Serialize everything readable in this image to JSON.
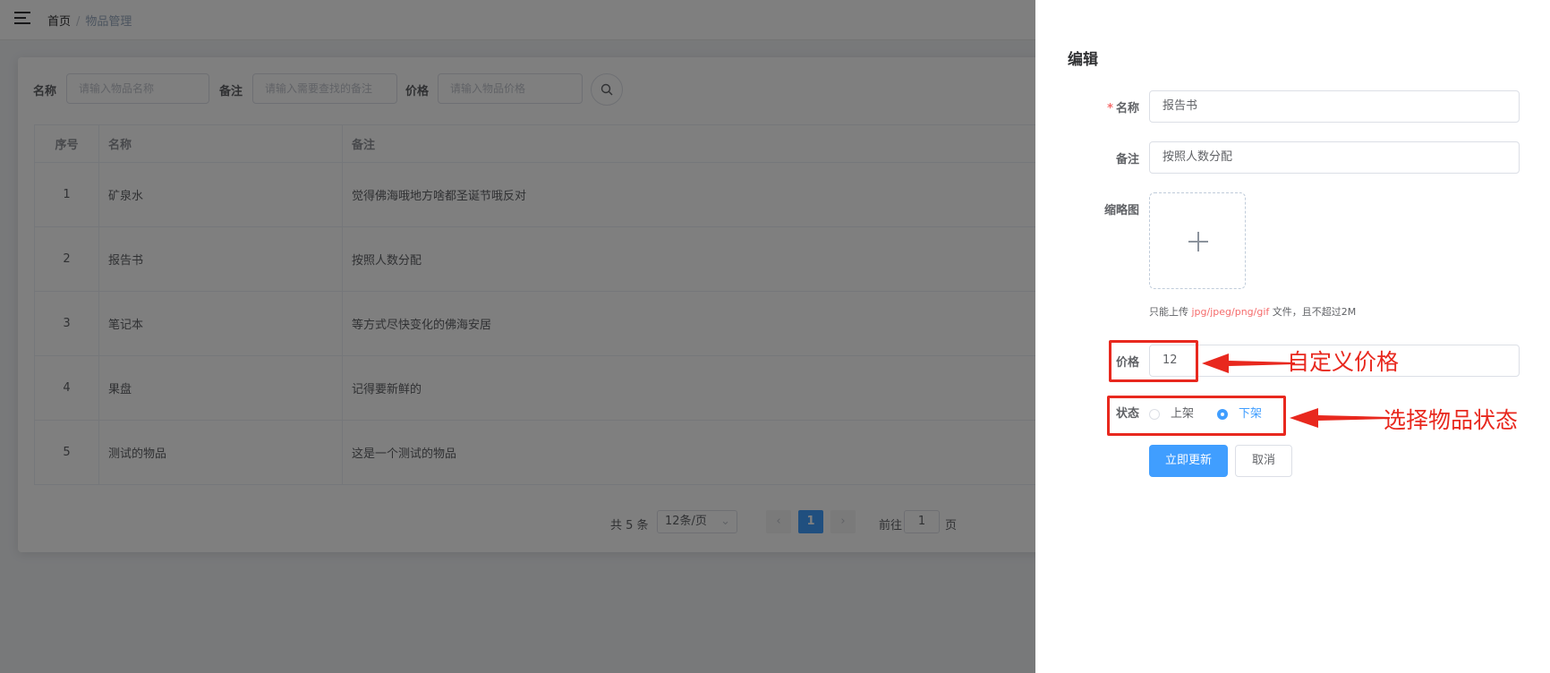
{
  "header": {
    "breadcrumb_home": "首页",
    "breadcrumb_sep": "/",
    "breadcrumb_current": "物品管理"
  },
  "search": {
    "name_label": "名称",
    "name_placeholder": "请输入物品名称",
    "remark_label": "备注",
    "remark_placeholder": "请输入需要查找的备注",
    "price_label": "价格",
    "price_placeholder": "请输入物品价格"
  },
  "table": {
    "columns": [
      "序号",
      "名称",
      "备注"
    ],
    "rows": [
      {
        "idx": "1",
        "name": "矿泉水",
        "remark": "觉得佛海哦地方啥都圣诞节哦反对"
      },
      {
        "idx": "2",
        "name": "报告书",
        "remark": "按照人数分配"
      },
      {
        "idx": "3",
        "name": "笔记本",
        "remark": "等方式尽快变化的佛海安居"
      },
      {
        "idx": "4",
        "name": "果盘",
        "remark": "记得要新鲜的"
      },
      {
        "idx": "5",
        "name": "测试的物品",
        "remark": "这是一个测试的物品"
      }
    ]
  },
  "pagination": {
    "total": "共 5 条",
    "page_size": "12条/页",
    "current_page": "1",
    "goto_label": "前往",
    "goto_value": "1",
    "page_suffix": "页"
  },
  "drawer": {
    "title": "编辑",
    "name_label": "名称",
    "name_value": "报告书",
    "remark_label": "备注",
    "remark_value": "按照人数分配",
    "thumb_label": "缩略图",
    "upload_tip_pre": "只能上传",
    "upload_tip_types": "jpg/jpeg/png/gif",
    "upload_tip_post": "文件，且不超过2M",
    "price_label": "价格",
    "price_value": "12",
    "status_label": "状态",
    "status_options": [
      "上架",
      "下架"
    ],
    "status_selected": "下架",
    "submit_label": "立即更新",
    "cancel_label": "取消"
  },
  "annotations": {
    "price_note": "自定义价格",
    "status_note": "选择物品状态",
    "color": "#e8281e"
  },
  "colors": {
    "primary": "#409eff",
    "danger": "#f56c6c",
    "overlay": "rgba(0,0,0,0.5)"
  }
}
